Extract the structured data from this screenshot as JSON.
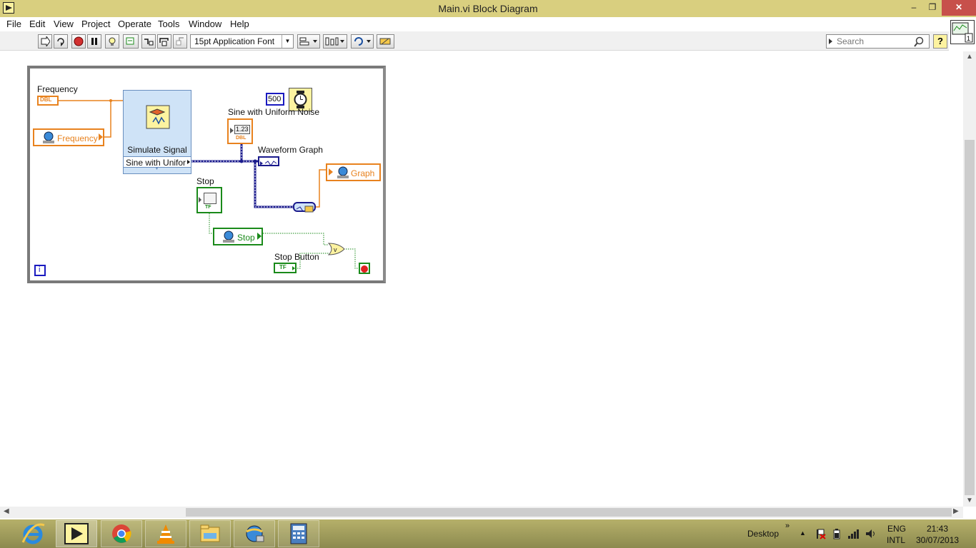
{
  "window": {
    "title": "Main.vi Block Diagram",
    "minimize": "–",
    "maximize": "❐",
    "close": "✕"
  },
  "menu": [
    "File",
    "Edit",
    "View",
    "Project",
    "Operate",
    "Tools",
    "Window",
    "Help"
  ],
  "toolbar": {
    "font": "15pt Application Font",
    "search_placeholder": "Search",
    "help": "?"
  },
  "diagram": {
    "frequency_label": "Frequency",
    "frequency_terminal": "DBL",
    "frequency_var": "Frequency",
    "simulate_signal": "Simulate Signal",
    "simulate_output": "Sine with Unifor",
    "wait_constant": "500",
    "sine_label": "Sine with Uniform Noise",
    "sine_indicator": "1.23",
    "sine_terminal": "DBL",
    "waveform_label": "Waveform Graph",
    "graph_var": "Graph",
    "stop_label": "Stop",
    "stop_terminal": "TF",
    "stop_var": "Stop",
    "stop_button_label": "Stop Button",
    "stop_button_terminal": "TF",
    "iteration": "i"
  },
  "tray": {
    "desktop": "Desktop",
    "lang": "ENG",
    "layout": "INTL",
    "time": "21:43",
    "date": "30/07/2013"
  },
  "colors": {
    "titlebar": "#d9cf7f",
    "orange_wire": "#e8821e",
    "green_wire": "#1a8a1a",
    "blue_wire": "#1a1a8c"
  }
}
